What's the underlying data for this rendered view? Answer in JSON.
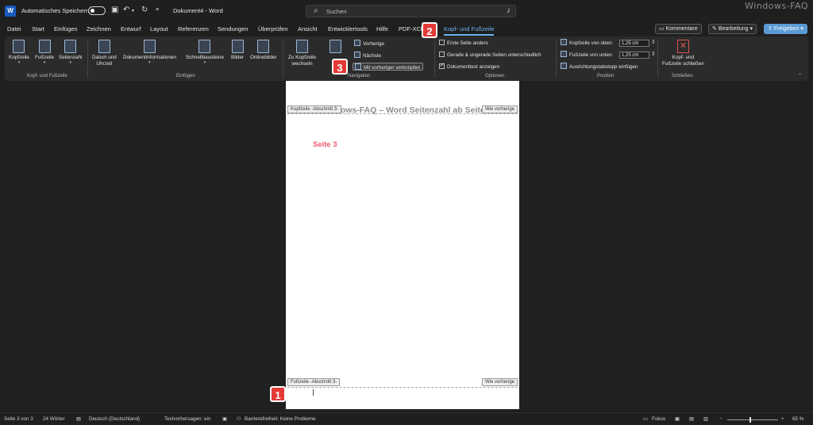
{
  "titlebar": {
    "autosave_label": "Automatisches Speichern",
    "doc_title": "Dokument4 - Word",
    "search_placeholder": "Suchen",
    "watermark": "Windows-FAQ"
  },
  "menu": {
    "tabs": [
      "Datei",
      "Start",
      "Einfügen",
      "Zeichnen",
      "Entwurf",
      "Layout",
      "Referenzen",
      "Sendungen",
      "Überprüfen",
      "Ansicht",
      "Entwicklertools",
      "Hilfe",
      "PDF-XCh",
      "Kopf- und Fußzeile"
    ],
    "active_tab": "Kopf- und Fußzeile",
    "comments_label": "Kommentare",
    "editing_label": "Bearbeitung",
    "share_label": "Freigeben"
  },
  "ribbon": {
    "hf_group": {
      "label": "Kopf- und Fußzeile",
      "kopfzeile": "Kopfzeile",
      "fusszeile": "Fußzeile",
      "seitenzahl": "Seitenzahl"
    },
    "insert_group": {
      "label": "Einfügen",
      "datum1": "Datum und",
      "datum2": "Uhrzeit",
      "dokinfo": "Dokumentinformationen",
      "schnell": "Schnellbausteine",
      "bilder": "Bilder",
      "online": "Onlinebilder"
    },
    "nav_group": {
      "label": "Navigation",
      "zukopf1": "Zu Kopfzeile",
      "zukopf2": "wechseln",
      "vorherige": "Vorherige",
      "naechste": "Nächste",
      "verknuepfen": "Mit vorheriger verknüpfen"
    },
    "options_group": {
      "label": "Optionen",
      "erste": "Erste Seite anders",
      "gerade": "Gerade & ungerade Seiten unterschiedlich",
      "doktext": "Dokumenttext anzeigen",
      "erste_checked": false,
      "gerade_checked": false,
      "doktext_checked": true
    },
    "position_group": {
      "label": "Position",
      "kopf_oben": "Kopfzeile von oben:",
      "kopf_oben_val": "1,25 cm",
      "fuss_unten": "Fußzeile von unten:",
      "fuss_unten_val": "1,25 cm",
      "tab_stop": "Ausrichtungstabstopp einfügen"
    },
    "close_group": {
      "label": "Schließen",
      "close1": "Kopf- und",
      "close2": "Fußzeile schließen"
    }
  },
  "document": {
    "header_title": "Windows-FAQ – Word Seitenzahl ab Seite",
    "header_tag": "Kopfzeile -Abschnitt 3-",
    "same_as_prev": "Wie vorherige",
    "body_text": "Seite 3",
    "footer_tag": "Fußzeile -Abschnitt 3-",
    "footer_same_as_prev": "Wie vorherige"
  },
  "annotations": [
    "1",
    "2",
    "3"
  ],
  "statusbar": {
    "page": "Seite 3 von 3",
    "words": "24 Wörter",
    "language": "Deutsch (Deutschland)",
    "predictions": "Textvorhersagen: ein",
    "accessibility": "Barrierefreiheit: Keine Probleme",
    "focus": "Fokus",
    "zoom": "65 %"
  }
}
